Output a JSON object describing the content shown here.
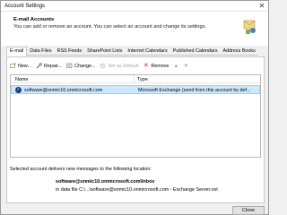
{
  "window": {
    "title": "Account Settings"
  },
  "header": {
    "title": "E-mail Accounts",
    "subtitle": "You can add or remove an account. You can select an account and change its settings."
  },
  "tabs": [
    {
      "label": "E-mail",
      "active": true
    },
    {
      "label": "Data Files",
      "active": false
    },
    {
      "label": "RSS Feeds",
      "active": false
    },
    {
      "label": "SharePoint Lists",
      "active": false
    },
    {
      "label": "Internet Calendars",
      "active": false
    },
    {
      "label": "Published Calendars",
      "active": false
    },
    {
      "label": "Address Books",
      "active": false
    }
  ],
  "toolbar": {
    "new_label": "New...",
    "repair_label": "Repair...",
    "change_label": "Change...",
    "default_label": "Set as Default",
    "remove_label": "Remove"
  },
  "list": {
    "col_name": "Name",
    "col_type": "Type",
    "rows": [
      {
        "name": "software@onmic10.onmicrosoft.com",
        "type": "Microsoft Exchange (send from this account by def..."
      }
    ]
  },
  "delivery": {
    "description": "Selected account delivers new messages to the following location:",
    "location": "software@onmic10.onmicrosoft.com\\Inbox",
    "file": "in data file C:\\...\\software@onmic10.onmicrosoft.com - Exchange Server.ost"
  },
  "footer": {
    "close_label": "Close"
  },
  "colors": {
    "selection": "#cce8ff",
    "accent": "#1e3f7a"
  }
}
